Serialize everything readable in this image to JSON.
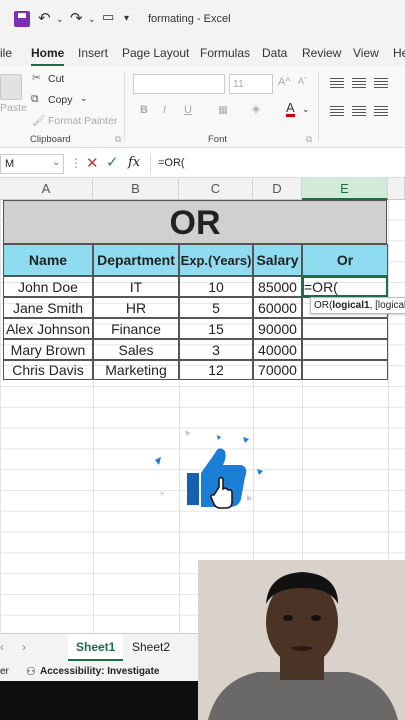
{
  "titlebar": {
    "file_title": "formating  -  Excel"
  },
  "tabs": [
    "ile",
    "Home",
    "Insert",
    "Page Layout",
    "Formulas",
    "Data",
    "Review",
    "View",
    "Hel"
  ],
  "ribbon": {
    "paste": "Paste",
    "cut": "Cut",
    "copy": "Copy",
    "format_painter": "Format Painter",
    "clipboard_label": "Clipboard",
    "font_size": "11",
    "bold": "B",
    "italic": "I",
    "underline": "U",
    "font_label": "Font",
    "font_color_letter": "A"
  },
  "formula_bar": {
    "name_box": "M",
    "fx": "fx",
    "content": "=OR("
  },
  "columns": [
    "A",
    "B",
    "C",
    "D",
    "E"
  ],
  "sheet": {
    "title": "OR",
    "headers": [
      "Name",
      "Department",
      "Exp.(Years)",
      "Salary",
      "Or"
    ],
    "rows": [
      [
        "John Doe",
        "IT",
        "10",
        "85000",
        "=OR("
      ],
      [
        "Jane Smith",
        "HR",
        "5",
        "60000",
        ""
      ],
      [
        "Alex Johnson",
        "Finance",
        "15",
        "90000",
        ""
      ],
      [
        "Mary Brown",
        "Sales",
        "3",
        "40000",
        ""
      ],
      [
        "Chris Davis",
        "Marketing",
        "12",
        "70000",
        ""
      ]
    ],
    "tooltip_prefix": "OR(",
    "tooltip_arg": "logical1",
    "tooltip_rest": ", [logical"
  },
  "sheet_tabs": [
    "Sheet1",
    "Sheet2"
  ],
  "status": {
    "left": "er",
    "accessibility": "Accessibility: Investigate"
  },
  "colors": {
    "accent": "#1f6e43",
    "header_fill": "#8fdcf0",
    "title_fill": "#d0d0d0",
    "thumb": "#1a7fd4"
  }
}
